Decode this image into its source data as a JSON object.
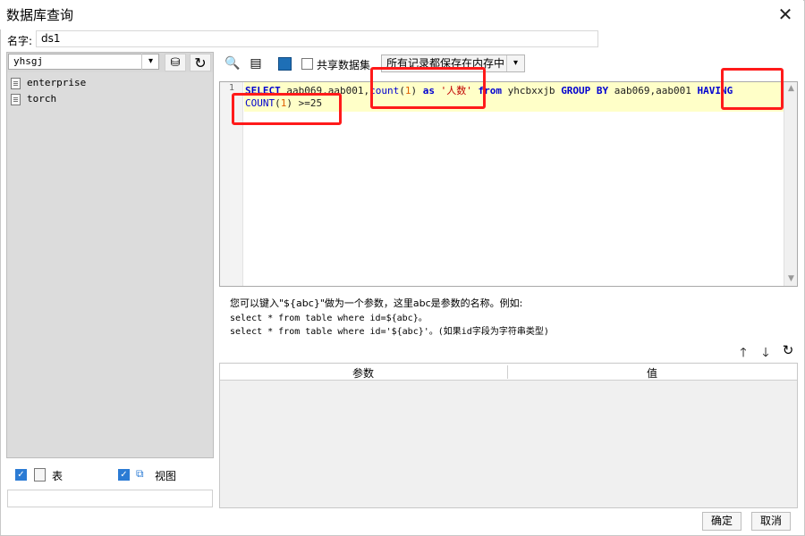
{
  "window": {
    "title": "数据库查询",
    "close_glyph": "✕"
  },
  "name_row": {
    "label": "名字:",
    "value": "ds1"
  },
  "left_panel": {
    "connection": "yhsgj",
    "tables": [
      "enterprise",
      "torch"
    ],
    "show_table_label": "表",
    "show_view_label": "视图",
    "filter_value": ""
  },
  "toolbar": {
    "share_label": "共享数据集",
    "cache_option": "所有记录都保存在内存中"
  },
  "editor": {
    "line_number": "1",
    "line1": [
      {
        "t": "SELECT ",
        "c": "kw"
      },
      {
        "t": "aab069,aab001,",
        "c": "id"
      },
      {
        "t": "count",
        "c": "fn"
      },
      {
        "t": "(",
        "c": "id"
      },
      {
        "t": "1",
        "c": "num"
      },
      {
        "t": ") ",
        "c": "id"
      },
      {
        "t": "as ",
        "c": "kw"
      },
      {
        "t": "'人数'",
        "c": "str"
      },
      {
        "t": " ",
        "c": "id"
      },
      {
        "t": "from ",
        "c": "kw"
      },
      {
        "t": "yhcbxxjb ",
        "c": "id"
      },
      {
        "t": "GROUP BY ",
        "c": "kw"
      },
      {
        "t": "aab069,aab001 ",
        "c": "id"
      },
      {
        "t": "HAVING",
        "c": "kw"
      }
    ],
    "line2": [
      {
        "t": "COUNT",
        "c": "fn"
      },
      {
        "t": "(",
        "c": "id"
      },
      {
        "t": "1",
        "c": "num"
      },
      {
        "t": ") >=25",
        "c": "id"
      }
    ]
  },
  "hints": {
    "line1": "您可以键入\"${abc}\"做为一个参数，这里abc是参数的名称。例如:",
    "line2": "select * from table where id=${abc}。",
    "line3": "select * from table where id='${abc}'。(如果id字段为字符串类型)"
  },
  "param_table": {
    "col_param": "参数",
    "col_value": "值"
  },
  "footer": {
    "ok": "确定",
    "cancel": "取消"
  },
  "colors": {
    "annotation": "#ff1a1a",
    "keyword": "#0000d0",
    "number": "#e06000",
    "string": "#c00000",
    "checkbox": "#2b7bd4",
    "highlight": "#ffffc8"
  }
}
